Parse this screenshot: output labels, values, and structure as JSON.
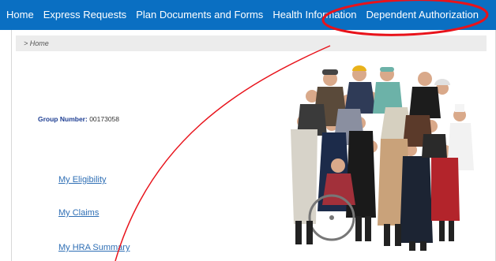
{
  "nav": {
    "items": [
      "Home",
      "Express Requests",
      "Plan Documents and Forms",
      "Health Information",
      "Dependent Authorization"
    ]
  },
  "breadcrumb": "> Home",
  "group": {
    "label": "Group Number:",
    "value": "00173058"
  },
  "links": [
    "My Eligibility",
    "My Claims",
    "My HRA Summary"
  ],
  "colors": {
    "nav_bg": "#0a6fc2",
    "link": "#2f6fb5",
    "annotation": "#e8131b"
  },
  "image": {
    "icon": "people-group-photo"
  }
}
